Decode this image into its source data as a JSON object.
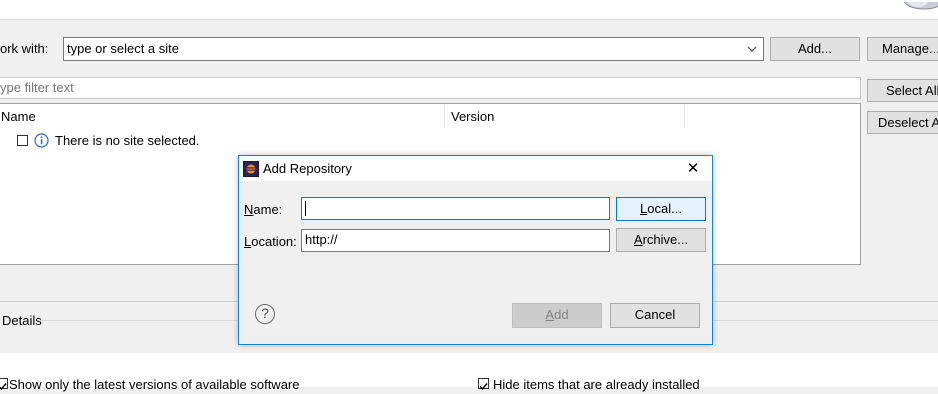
{
  "work_with": {
    "label_visible": "ork with:",
    "combo_value": "type or select a site",
    "add_button": "Add...",
    "manage_button": "Manage..."
  },
  "filter": {
    "placeholder_visible": "ype filter text"
  },
  "side_buttons": {
    "select_all": "Select All",
    "deselect_all": "Deselect A"
  },
  "table": {
    "headers": [
      "Name",
      "Version"
    ],
    "rows": [
      {
        "text": "There is no site selected.",
        "checked": false,
        "icon": "info-icon"
      }
    ]
  },
  "details": {
    "label": "Details"
  },
  "options": {
    "show_latest": {
      "label": "Show only the latest versions of available software",
      "checked": true
    },
    "hide_installed": {
      "label": "Hide items that are already installed",
      "checked": true
    }
  },
  "dialog": {
    "title": "Add Repository",
    "close": "✕",
    "name_label": "Name:",
    "name_mnemonic": "N",
    "name_rest": "ame:",
    "name_value": "",
    "location_label": "Location:",
    "location_mnemonic": "L",
    "location_rest": "ocation:",
    "location_value": "http://",
    "local_button_mn": "L",
    "local_button_rest": "ocal...",
    "archive_button_mn": "A",
    "archive_button_rest": "rchive...",
    "add_button_mn": "A",
    "add_button_rest": "dd",
    "cancel_button": "Cancel",
    "help_glyph": "?"
  },
  "colors": {
    "accent": "#1883d7",
    "info_blue": "#1e6fd0"
  }
}
